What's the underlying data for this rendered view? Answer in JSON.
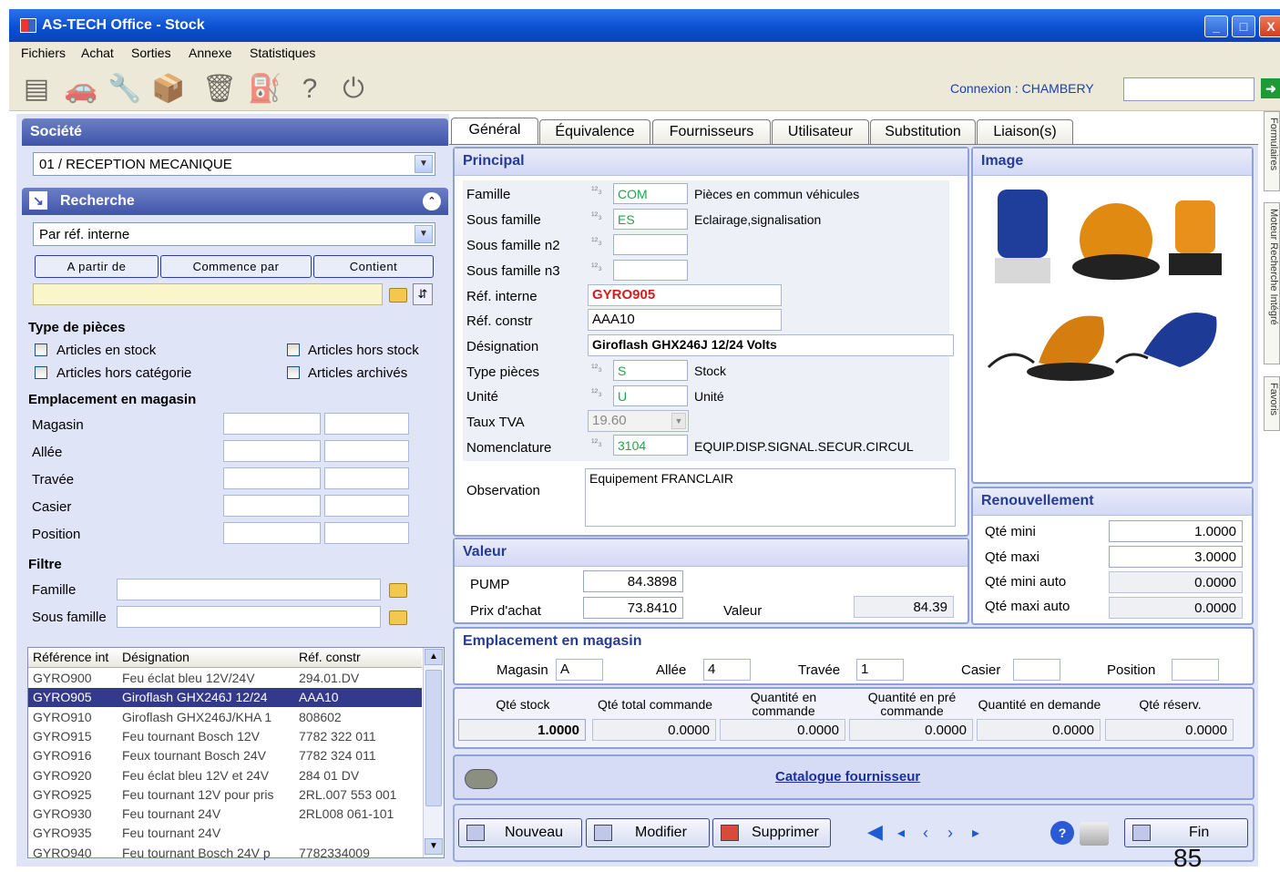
{
  "window": {
    "title": "AS-TECH Office - Stock",
    "minimize": "_",
    "maximize": "□",
    "close": "X"
  },
  "menu": [
    "Fichiers",
    "Achat",
    "Sorties",
    "Annexe",
    "Statistiques"
  ],
  "toolbar": {
    "connexion": "Connexion : CHAMBERY",
    "connexion_value": ""
  },
  "side_tabs": [
    "Formulaires",
    "Moteur Recherche Intégré",
    "Favoris"
  ],
  "left": {
    "societe_title": "Société",
    "societe_value": "01 / RECEPTION MECANIQUE",
    "recherche_title": "Recherche",
    "search_mode": "Par réf. interne",
    "search_buttons": [
      "A partir de",
      "Commence par",
      "Contient"
    ],
    "search_value": "",
    "type_title": "Type de pièces",
    "checkboxes": [
      "Articles en stock",
      "Articles hors stock",
      "Articles hors catégorie",
      "Articles archivés"
    ],
    "emplacement_title": "Emplacement en magasin",
    "emplacement_fields": [
      "Magasin",
      "Allée",
      "Travée",
      "Casier",
      "Position"
    ],
    "filtre_title": "Filtre",
    "filtre_fields": [
      "Famille",
      "Sous famille"
    ]
  },
  "grid": {
    "columns": [
      "Référence int",
      "Désignation",
      "Réf. constr"
    ],
    "rows": [
      [
        "GYRO900",
        "Feu éclat bleu 12V/24V",
        "294.01.DV"
      ],
      [
        "GYRO905",
        "Giroflash GHX246J 12/24",
        "AAA10"
      ],
      [
        "GYRO910",
        "Giroflash GHX246J/KHA 1",
        "808602"
      ],
      [
        "GYRO915",
        "Feu tournant Bosch 12V",
        "7782 322 011"
      ],
      [
        "GYRO916",
        "Feux tournant Bosch 24V",
        "7782 324 011"
      ],
      [
        "GYRO920",
        "Feu éclat bleu 12V et 24V",
        "284 01 DV"
      ],
      [
        "GYRO925",
        "Feu tournant 12V pour pris",
        "2RL.007 553 001"
      ],
      [
        "GYRO930",
        "Feu tournant 24V",
        "2RL008 061-101"
      ],
      [
        "GYRO935",
        "Feu tournant 24V",
        ""
      ],
      [
        "GYRO940",
        "Feu tournant Bosch 24V p",
        "7782334009"
      ]
    ],
    "selected_index": 1
  },
  "tabs": [
    "Général",
    "Équivalence",
    "Fournisseurs",
    "Utilisateur",
    "Substitution",
    "Liaison(s)"
  ],
  "principal": {
    "title": "Principal",
    "famille": {
      "label": "Famille",
      "code": "COM",
      "desc": "Pièces en commun véhicules"
    },
    "sous_famille": {
      "label": "Sous famille",
      "code": "ES",
      "desc": "Eclairage,signalisation"
    },
    "sous_famille_n2": {
      "label": "Sous famille n2",
      "code": ""
    },
    "sous_famille_n3": {
      "label": "Sous famille n3",
      "code": ""
    },
    "ref_interne": {
      "label": "Réf. interne",
      "value": "GYRO905"
    },
    "ref_constr": {
      "label": "Réf. constr",
      "value": "AAA10"
    },
    "designation": {
      "label": "Désignation",
      "value": "Giroflash GHX246J 12/24 Volts"
    },
    "type_pieces": {
      "label": "Type pièces",
      "code": "S",
      "desc": "Stock"
    },
    "unite": {
      "label": "Unité",
      "code": "U",
      "desc": "Unité"
    },
    "taux_tva": {
      "label": "Taux TVA",
      "value": "19.60"
    },
    "nomenclature": {
      "label": "Nomenclature",
      "code": "3104",
      "desc": "EQUIP.DISP.SIGNAL.SECUR.CIRCUL"
    },
    "observation": {
      "label": "Observation",
      "value": "Equipement FRANCLAIR"
    },
    "glyph": "¹²₃"
  },
  "image_title": "Image",
  "renouvellement": {
    "title": "Renouvellement",
    "rows": [
      [
        "Qté mini",
        "1.0000"
      ],
      [
        "Qté maxi",
        "3.0000"
      ],
      [
        "Qté mini auto",
        "0.0000"
      ],
      [
        "Qté maxi auto",
        "0.0000"
      ]
    ]
  },
  "valeur": {
    "title": "Valeur",
    "pump_label": "PUMP",
    "pump": "84.3898",
    "prix_label": "Prix d'achat",
    "prix": "73.8410",
    "valeur_label": "Valeur",
    "valeur": "84.39"
  },
  "emplacement": {
    "title": "Emplacement en magasin",
    "magasin_label": "Magasin",
    "magasin": "A",
    "allee_label": "Allée",
    "allee": "4",
    "travee_label": "Travée",
    "travee": "1",
    "casier_label": "Casier",
    "casier": "",
    "position_label": "Position",
    "position": ""
  },
  "stock": {
    "headers": [
      "Qté stock",
      "Qté total commande",
      "Quantité en commande",
      "Quantité en pré commande",
      "Quantité en demande",
      "Qté réserv."
    ],
    "values": [
      "1.0000",
      "0.0000",
      "0.0000",
      "0.0000",
      "0.0000",
      "0.0000"
    ]
  },
  "catalogue": "Catalogue fournisseur",
  "buttons": {
    "nouveau": "Nouveau",
    "modifier": "Modifier",
    "supprimer": "Supprimer",
    "fin": "Fin"
  },
  "nav": [
    "◀",
    "◂",
    "‹",
    "›",
    "▸"
  ],
  "corner_text": "85",
  "colors": {
    "title_bar": "#0a4ed0",
    "panel_head": "#4155a8",
    "accent_red": "#d81b1b",
    "code_green": "#1ba84a",
    "link": "#1c2fa0"
  }
}
